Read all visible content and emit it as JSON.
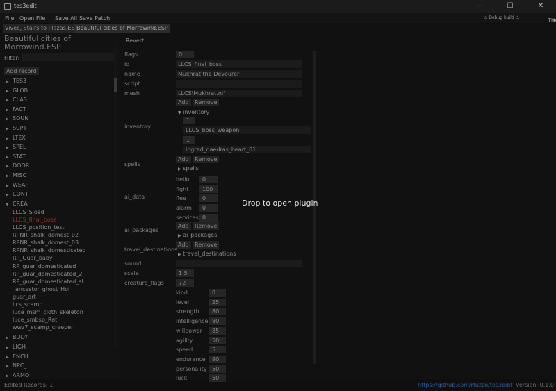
{
  "window": {
    "title": "tes3edit",
    "controls": [
      "—",
      "☐",
      "✕"
    ]
  },
  "menu": {
    "file": "File",
    "open_file": "Open File",
    "save_all": "Save All",
    "save_patch": "Save Patch",
    "debug_badge": "⚠ Debug build ⚠",
    "theme_label": "Theme:",
    "theme_icon": "☀"
  },
  "tabs": [
    "Vivec, Stairs to Plazas.ESP",
    "Beautiful cities of Morrowind.ESP"
  ],
  "sidebar": {
    "plugin_title": "Beautiful cities of Morrowind.ESP",
    "filter_label": "Filter:",
    "filter_value": "",
    "add_record": "Add record",
    "groups_before": [
      "TES3",
      "GLOB",
      "CLAS",
      "FACT",
      "SOUN",
      "SCPT",
      "LTEX",
      "SPEL",
      "STAT",
      "DOOR",
      "MISC",
      "WEAP",
      "CONT"
    ],
    "open_group": "CREA",
    "crea_items": [
      "LLCS_Sload",
      "LLCS_final_boss",
      "LLCS_position_test",
      "RPNR_shalk_domest_02",
      "RPNR_shalk_domest_03",
      "RPNR_shalk_domesticated",
      "RP_Guar_baby",
      "RP_guar_domesticated",
      "RP_guar_domesticated_2",
      "RP_guar_domesticated_sl",
      "_ancestor_ghost_Hoi",
      "guar_art",
      "llcs_scamp",
      "luce_msm_cloth_skeleton",
      "luce_smbsp_Rat",
      "wwz7_scamp_creeper"
    ],
    "groups_after": [
      "BODY",
      "LIGH",
      "ENCH",
      "NPC_",
      "ARMO"
    ]
  },
  "status": {
    "edited": "Edited Records: 1",
    "link": "https://github.com/rfuzzo/tes3edit",
    "version": "Version:  0.1.0"
  },
  "editor": {
    "revert": "Revert",
    "labels": {
      "flags": "flags",
      "id": "id",
      "name": "name",
      "script": "script",
      "mesh": "mesh",
      "inventory": "inventory",
      "spells": "spells",
      "ai_data": "ai_data",
      "ai_packages": "ai_packages",
      "travel_destinations": "travel_destinations",
      "sound": "sound",
      "scale": "scale",
      "creature_flags": "creature_flags"
    },
    "values": {
      "flags": "0",
      "id": "LLCS_final_boss",
      "name": "Mukhrat the Devourer",
      "script": "",
      "mesh": "LLCS\\Mukhrat.nif",
      "sound": "",
      "scale": "1.5",
      "creature_flags": "72"
    },
    "add_label": "Add",
    "remove_label": "Remove",
    "inventory_header": "inventory",
    "inventory": [
      {
        "count": "1",
        "id": "LLCS_boss_weapon"
      },
      {
        "count": "1",
        "id": "ingred_daedras_heart_01"
      }
    ],
    "spells_header": "spells",
    "ai_data": [
      {
        "k": "hello",
        "v": "0"
      },
      {
        "k": "fight",
        "v": "100"
      },
      {
        "k": "flee",
        "v": "0"
      },
      {
        "k": "alarm",
        "v": "0"
      },
      {
        "k": "services",
        "v": "0"
      }
    ],
    "ai_packages_header": "ai_packages",
    "travel_header": "travel_destinations",
    "stats": [
      {
        "k": "kind",
        "v": "0"
      },
      {
        "k": "level",
        "v": "25"
      },
      {
        "k": "strength",
        "v": "80"
      },
      {
        "k": "intelligence",
        "v": "80"
      },
      {
        "k": "willpower",
        "v": "85"
      },
      {
        "k": "agility",
        "v": "50"
      },
      {
        "k": "speed",
        "v": "5"
      },
      {
        "k": "endurance",
        "v": "90"
      },
      {
        "k": "personality",
        "v": "50"
      },
      {
        "k": "luck",
        "v": "50"
      }
    ]
  },
  "overlay": {
    "drop_text": "Drop to open plugin"
  },
  "colors": {
    "selected": "#9c2a2a",
    "link": "#2f5d9c",
    "debug": "#b07a2a"
  }
}
